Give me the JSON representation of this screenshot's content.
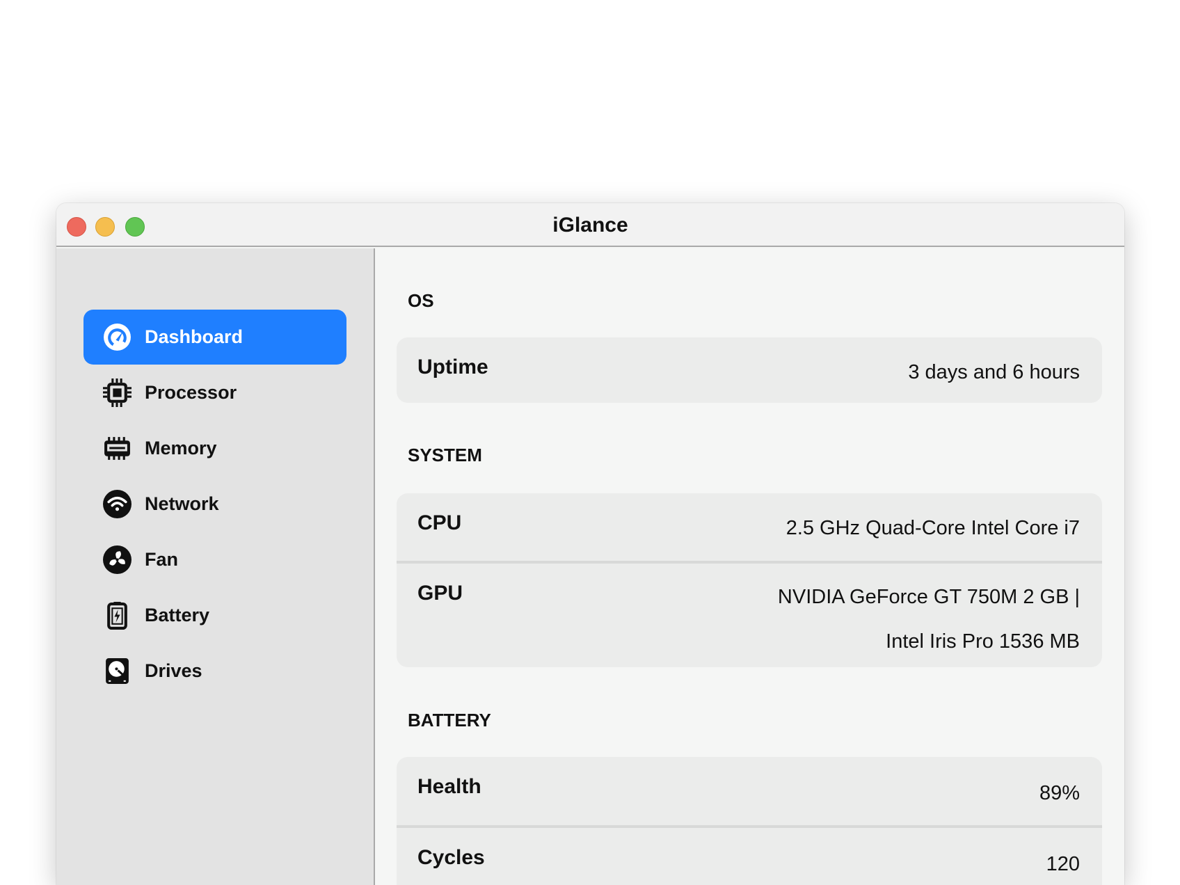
{
  "window": {
    "title": "iGlance"
  },
  "sidebar": {
    "items": [
      {
        "label": "Dashboard",
        "icon": "gauge-icon",
        "selected": true
      },
      {
        "label": "Processor",
        "icon": "cpu-icon"
      },
      {
        "label": "Memory",
        "icon": "memory-icon"
      },
      {
        "label": "Network",
        "icon": "wifi-icon"
      },
      {
        "label": "Fan",
        "icon": "fan-icon"
      },
      {
        "label": "Battery",
        "icon": "battery-icon"
      },
      {
        "label": "Drives",
        "icon": "drive-icon"
      }
    ]
  },
  "sections": {
    "os": {
      "heading": "OS",
      "rows": [
        {
          "label": "Uptime",
          "value": "3 days and 6 hours"
        }
      ]
    },
    "system": {
      "heading": "SYSTEM",
      "rows": [
        {
          "label": "CPU",
          "value": "2.5 GHz Quad-Core Intel Core i7"
        },
        {
          "label": "GPU",
          "value_line1": "NVIDIA GeForce GT 750M 2 GB |",
          "value_line2": "Intel Iris Pro 1536 MB"
        }
      ]
    },
    "battery": {
      "heading": "BATTERY",
      "rows": [
        {
          "label": "Health",
          "value": "89%"
        },
        {
          "label": "Cycles",
          "value": "120"
        }
      ]
    }
  },
  "colors": {
    "accent": "#1f7fff",
    "close": "#ee6a5e",
    "minimize": "#f5be4f",
    "zoom": "#61c554"
  }
}
